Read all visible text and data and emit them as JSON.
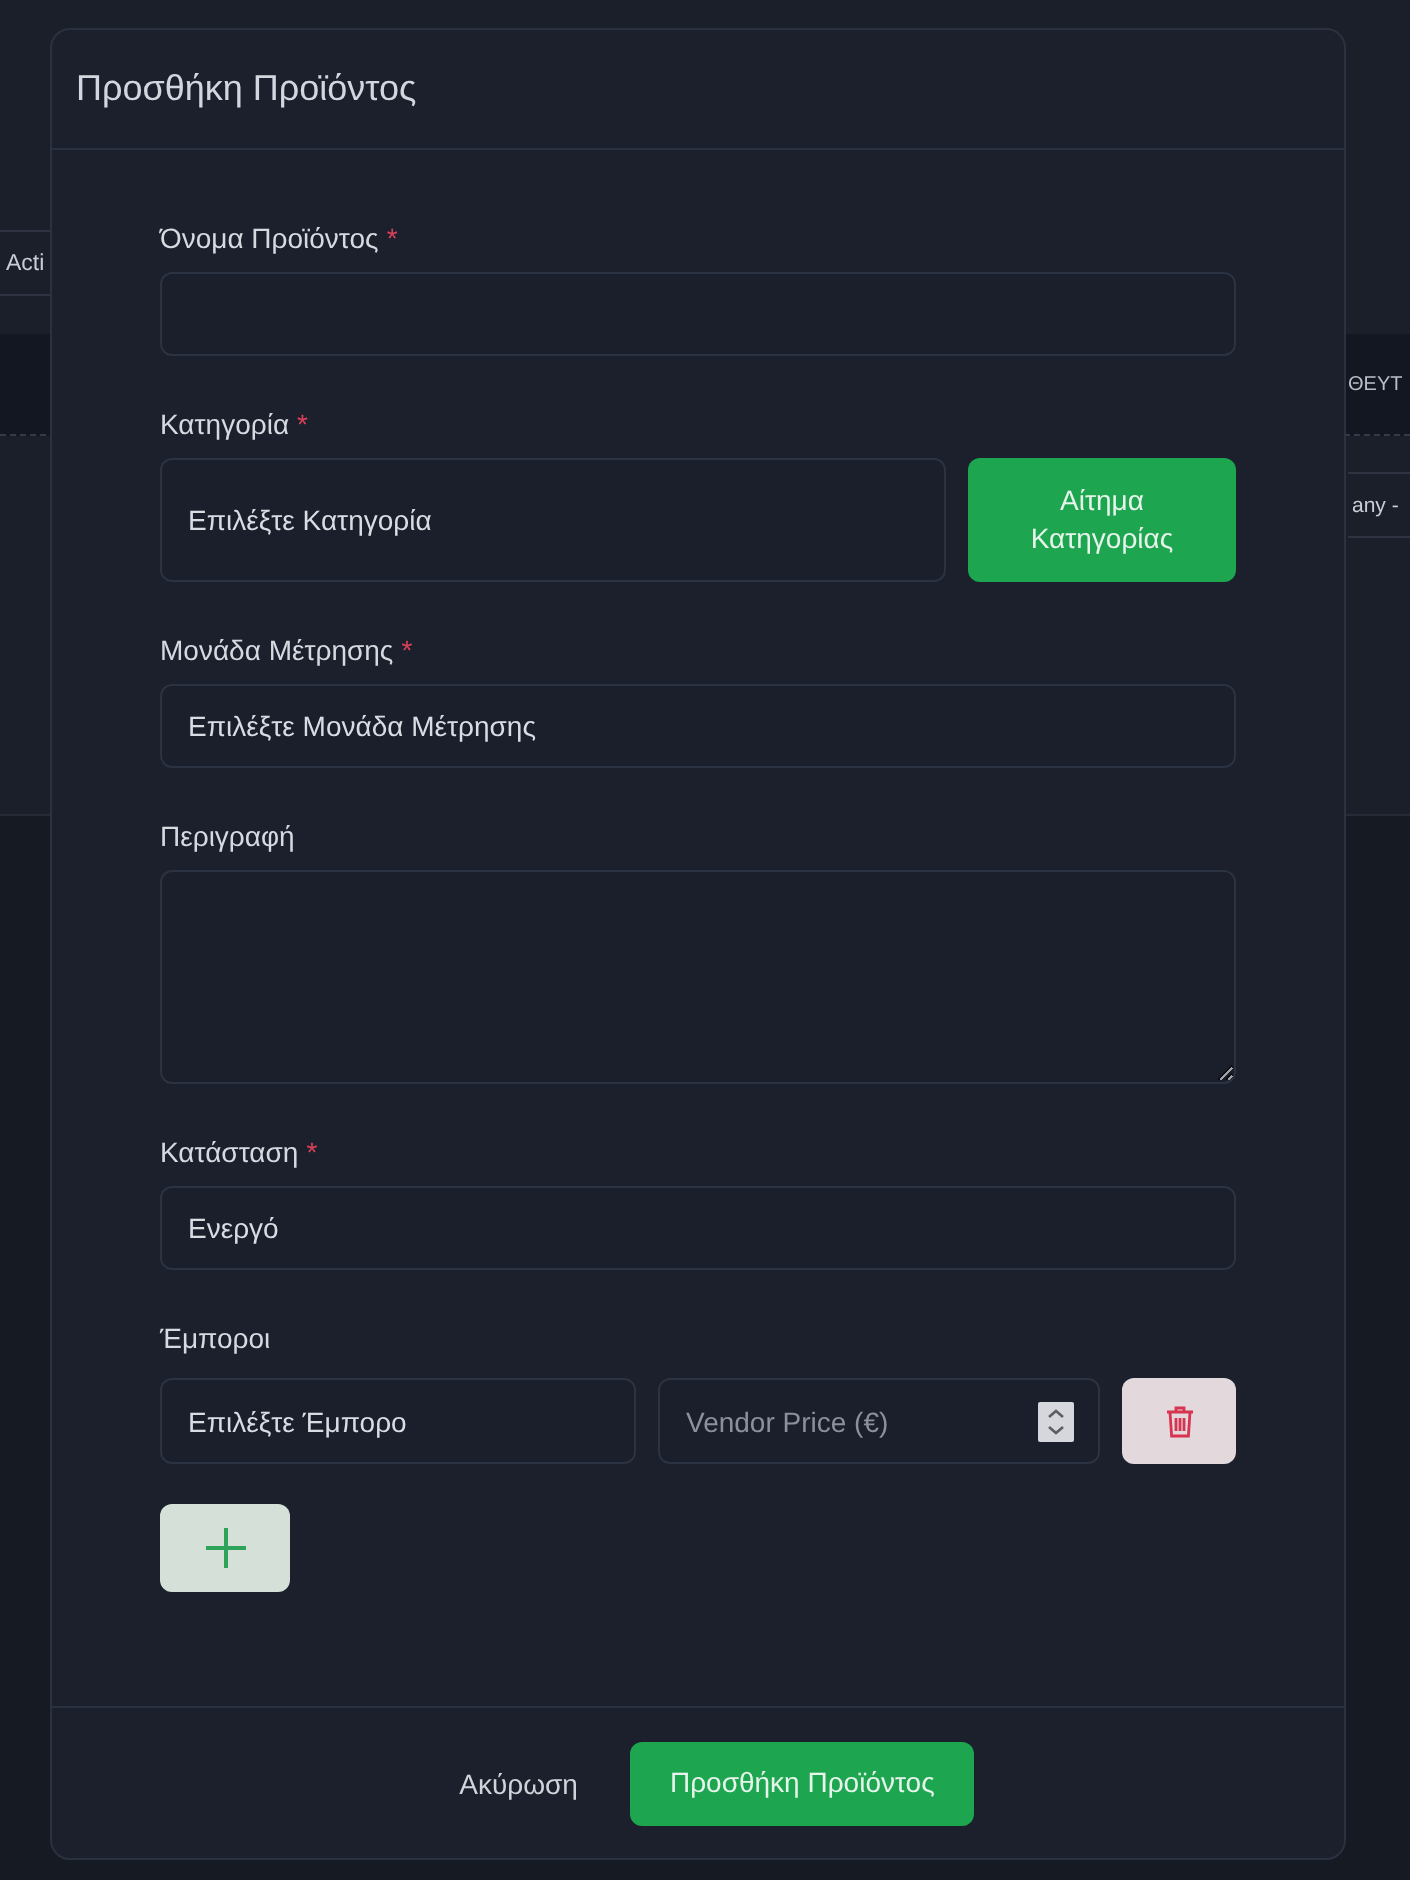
{
  "background": {
    "toolbar_button": "Acti",
    "table_header": "ΘΕΥΤ",
    "table_cell": "any -"
  },
  "dialog": {
    "title": "Προσθήκη Προϊόντος",
    "fields": [
      {
        "kind": "text",
        "label": "Όνομα Προϊόντος",
        "mark": "*"
      },
      {
        "kind": "select",
        "label": "Κατηγορία",
        "mark": "*",
        "placeholder": "Επιλέξτε Κατηγορία",
        "action": "Αίτημα Κατηγορίας"
      },
      {
        "kind": "select",
        "label": "Μονάδα Μέτρησης",
        "mark": "*",
        "placeholder": "Επιλέξτε Μονάδα Μέτρησης"
      },
      {
        "kind": "textarea",
        "label": "Περιγραφή"
      },
      {
        "kind": "select",
        "label": "Κατάσταση",
        "mark": "*",
        "value": "Ενεργό"
      }
    ],
    "vendors": {
      "label": "Έμποροι",
      "rows": [
        {
          "vendor_placeholder": "Επιλέξτε Έμπορο",
          "price_placeholder": "Vendor Price (€)"
        }
      ]
    },
    "buttons": {
      "cancel": "Ακύρωση",
      "submit": "Προσθήκη Προϊόντος"
    }
  }
}
